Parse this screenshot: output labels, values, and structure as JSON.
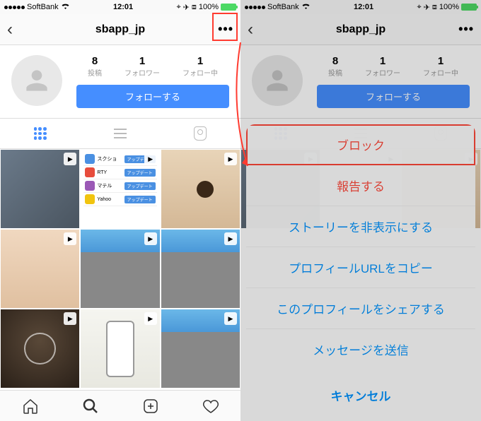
{
  "statusbar": {
    "carrier": "SoftBank",
    "time": "12:01",
    "battery": "100%"
  },
  "nav": {
    "username": "sbapp_jp"
  },
  "profile": {
    "stats": [
      {
        "count": "8",
        "label": "投稿"
      },
      {
        "count": "1",
        "label": "フォロワー"
      },
      {
        "count": "1",
        "label": "フォロー中"
      }
    ],
    "follow_btn": "フォローする"
  },
  "sheet": {
    "items": [
      {
        "label": "ブロック",
        "red": true,
        "hl": true
      },
      {
        "label": "報告する",
        "red": true
      },
      {
        "label": "ストーリーを非表示にする"
      },
      {
        "label": "プロフィールURLをコピー"
      },
      {
        "label": "このプロフィールをシェアする"
      },
      {
        "label": "メッセージを送信"
      }
    ],
    "cancel": "キャンセル"
  },
  "applist": {
    "btn": "アップデート"
  }
}
